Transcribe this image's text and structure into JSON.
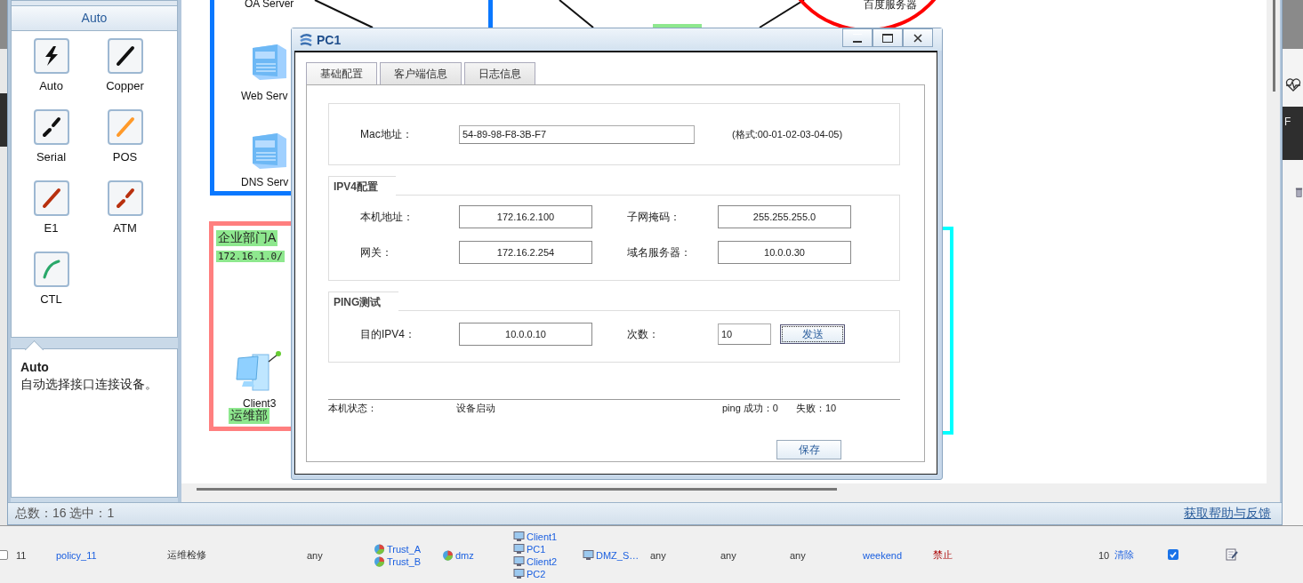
{
  "right_edge": {
    "texts": [
      "F"
    ]
  },
  "palette": {
    "title": "Auto",
    "items": [
      {
        "label": "Auto",
        "kind": "auto"
      },
      {
        "label": "Copper",
        "kind": "copper"
      },
      {
        "label": "Serial",
        "kind": "serial"
      },
      {
        "label": "POS",
        "kind": "pos"
      },
      {
        "label": "E1",
        "kind": "e1"
      },
      {
        "label": "ATM",
        "kind": "atm"
      },
      {
        "label": "CTL",
        "kind": "ctl"
      }
    ],
    "description": {
      "title": "Auto",
      "text": "自动选择接口连接设备。"
    }
  },
  "topology": {
    "areas": [
      {
        "kind": "rect",
        "color": "#0a78ff"
      },
      {
        "kind": "rect",
        "color": "#ff7f7f"
      },
      {
        "kind": "bracket",
        "color": "#00ffff"
      },
      {
        "kind": "circle",
        "color": "#ff0000"
      }
    ],
    "nodes": [
      {
        "kind": "label",
        "label": "OA Server"
      },
      {
        "kind": "label",
        "label": "百度服务器"
      },
      {
        "kind": "server",
        "label": "Web Serv"
      },
      {
        "kind": "server",
        "label": "DNS Serv"
      },
      {
        "kind": "pc",
        "label": "Client3"
      }
    ],
    "notes": [
      {
        "kind": "text",
        "text": "企业部门A"
      },
      {
        "kind": "mono",
        "text": "172.16.1.0/"
      },
      {
        "kind": "text",
        "text": "运维部"
      }
    ]
  },
  "status_bar": {
    "summary": "总数：16 选中：1",
    "help_link": "获取帮助与反馈"
  },
  "dialog": {
    "title": "PC1",
    "tabs": [
      {
        "label": "基础配置",
        "selected": true
      },
      {
        "label": "客户端信息",
        "selected": false
      },
      {
        "label": "日志信息",
        "selected": false
      }
    ],
    "mac": {
      "label": "Mac地址：",
      "value": "54-89-98-F8-3B-F7",
      "hint": "(格式:00-01-02-03-04-05)"
    },
    "ipv4": {
      "title": "IPV4配置",
      "fields": [
        {
          "label": "本机地址：",
          "value": "172.16.2.100"
        },
        {
          "label": "子网掩码：",
          "value": "255.255.255.0"
        },
        {
          "label": "网关：",
          "value": "172.16.2.254"
        },
        {
          "label": "域名服务器：",
          "value": "10.0.0.30"
        }
      ]
    },
    "ping": {
      "title": "PING测试",
      "target_label": "目的IPV4：",
      "target": "10.0.0.10",
      "count_label": "次数：",
      "count": "10",
      "send_button": "发送"
    },
    "status": {
      "label": "本机状态：",
      "value": "设备启动",
      "success": "ping 成功：0",
      "failure": "失败：10"
    },
    "save_button": "保存"
  },
  "policy_table": {
    "rows": [
      {
        "selected": false,
        "id": "11",
        "name": "policy_11",
        "description": "运维检修",
        "column_5": "any",
        "source_zones": [
          "Trust_A",
          "Trust_B"
        ],
        "destination_zones": [
          "dmz"
        ],
        "source_addresses": [
          "Client1",
          "PC1",
          "Client2",
          "PC2"
        ],
        "destination_addresses": [
          "DMZ_S…"
        ],
        "column_10": "any",
        "column_11": "any",
        "column_12": "any",
        "schedule": "weekend",
        "action": "禁止",
        "hits": "10",
        "clear_link": "清除",
        "enabled": true
      }
    ]
  }
}
